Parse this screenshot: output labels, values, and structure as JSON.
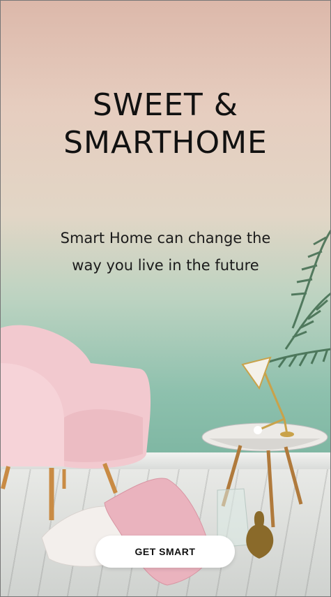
{
  "hero": {
    "title_line1": "SWEET &",
    "title_line2": "SMARTHOME",
    "subtitle_line1": "Smart Home can change the",
    "subtitle_line2": "way you live in the future"
  },
  "cta": {
    "label": "GET SMART"
  },
  "colors": {
    "armchair": "#f2c9cf",
    "wall_top": "#dcb8aa",
    "wall_bottom": "#7fb7a3",
    "button_bg": "#ffffff"
  },
  "icons": [
    "armchair-illustration",
    "side-table-illustration",
    "lamp-illustration",
    "plant-illustration",
    "pillow-illustration",
    "vase-illustration"
  ]
}
